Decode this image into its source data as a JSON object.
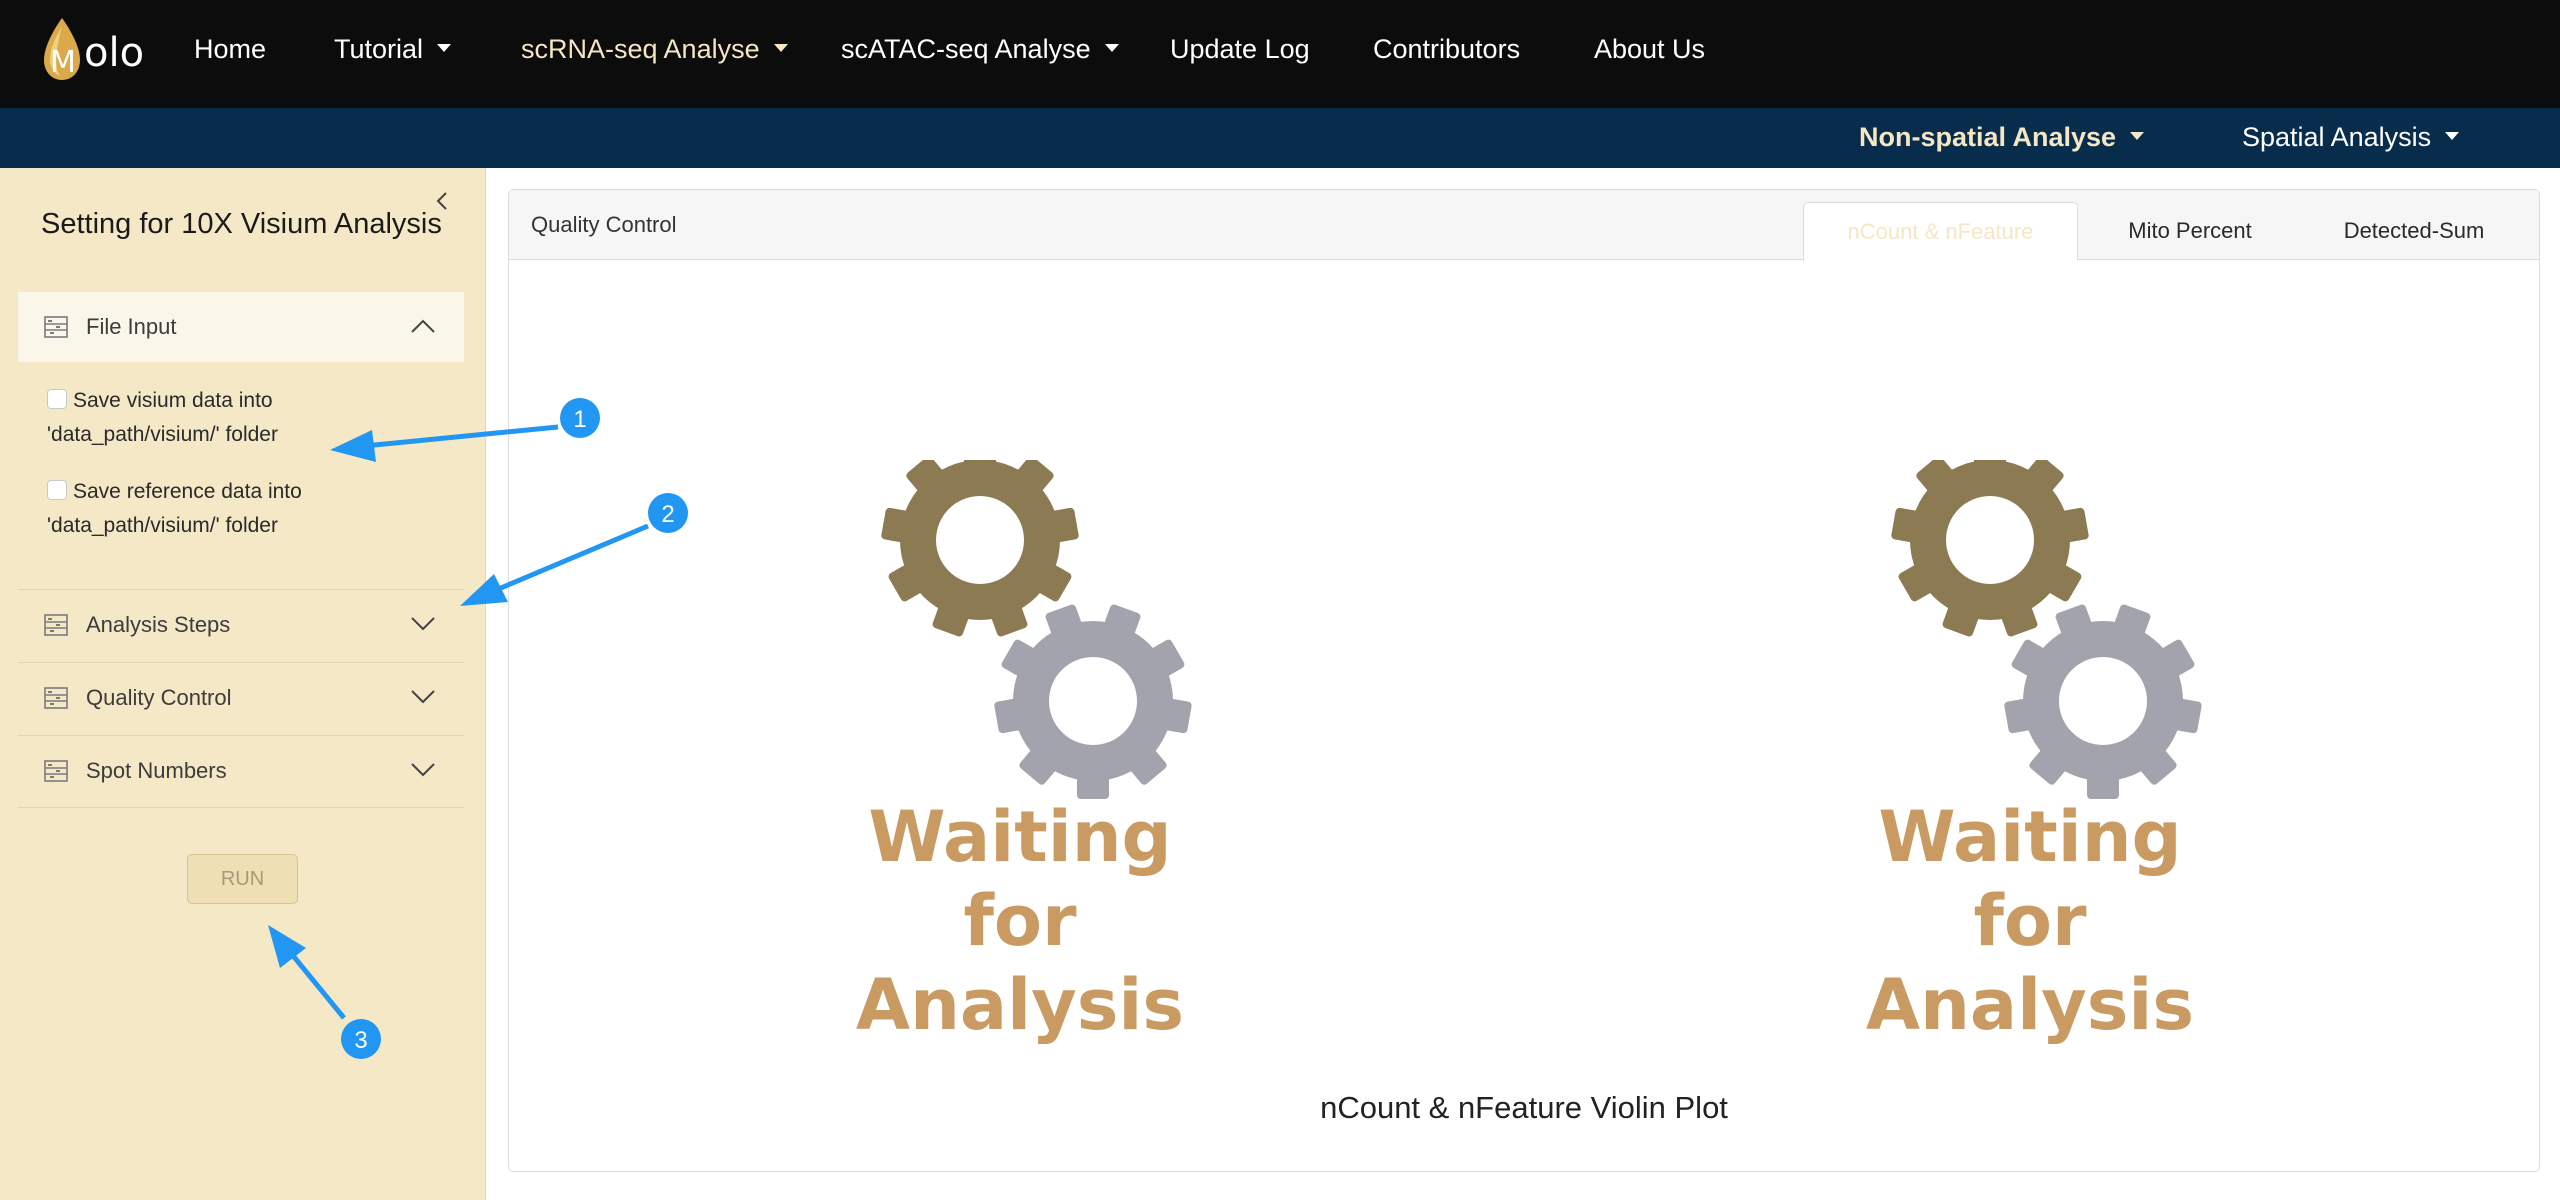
{
  "brand": {
    "logo_letter": "M",
    "logo_text": "olo"
  },
  "nav": {
    "items": [
      {
        "label": "Home",
        "dropdown": false
      },
      {
        "label": "Tutorial",
        "dropdown": true
      },
      {
        "label": "scRNA-seq Analyse",
        "dropdown": true
      },
      {
        "label": "scATAC-seq Analyse",
        "dropdown": true
      },
      {
        "label": "Update Log",
        "dropdown": false
      },
      {
        "label": "Contributors",
        "dropdown": false
      },
      {
        "label": "About Us",
        "dropdown": false
      }
    ],
    "active_index": 2
  },
  "subnav": {
    "items": [
      {
        "label": "Non-spatial Analyse"
      },
      {
        "label": "Spatial Analysis"
      }
    ],
    "active_index": 0
  },
  "sidebar": {
    "title": "Setting for 10X Visium Analysis",
    "collapse_icon": "chevron-left-icon",
    "file_input": {
      "label": "File Input",
      "expanded": true,
      "checkboxes": [
        {
          "line1": "Save visium data into",
          "line2": "'data_path/visium/' folder",
          "checked": false
        },
        {
          "line1": "Save reference data into",
          "line2": "'data_path/visium/' folder",
          "checked": false
        }
      ]
    },
    "sections": [
      {
        "label": "Analysis Steps",
        "expanded": false
      },
      {
        "label": "Quality Control",
        "expanded": false
      },
      {
        "label": "Spot Numbers",
        "expanded": false
      }
    ],
    "run_label": "RUN"
  },
  "annotations": [
    "1",
    "2",
    "3"
  ],
  "panel": {
    "title": "Quality Control",
    "tabs": [
      {
        "label": "nCount & nFeature"
      },
      {
        "label": "Mito Percent"
      },
      {
        "label": "Detected-Sum"
      }
    ],
    "active_tab": 0,
    "placeholder": {
      "line1": "Waiting for",
      "line2": "Analysis"
    },
    "caption": "nCount & nFeature Violin Plot"
  },
  "colors": {
    "topbar": "#0c0c0c",
    "subbar": "#082c4c",
    "sidebar": "#f5e8c7",
    "accent": "#f5e6c4",
    "gear_dark": "#8b7a52",
    "gear_light": "#a3a3ad",
    "wait_text": "#c99b62",
    "annotation": "#2196f3"
  }
}
